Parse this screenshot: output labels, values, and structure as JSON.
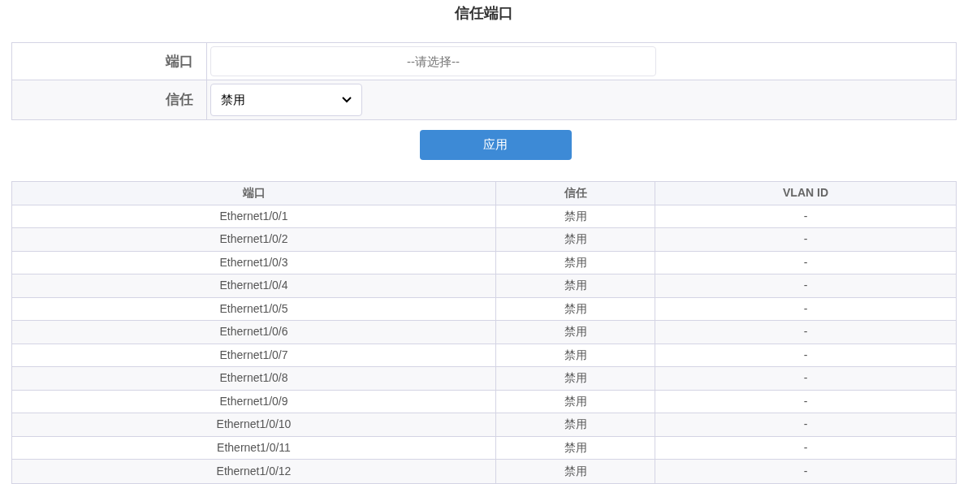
{
  "title": "信任端口",
  "form": {
    "port": {
      "label": "端口",
      "placeholder": "--请选择--"
    },
    "trust": {
      "label": "信任",
      "value": "禁用"
    }
  },
  "apply_button": "应用",
  "table": {
    "columns": [
      "端口",
      "信任",
      "VLAN ID"
    ],
    "rows": [
      [
        "Ethernet1/0/1",
        "禁用",
        "-"
      ],
      [
        "Ethernet1/0/2",
        "禁用",
        "-"
      ],
      [
        "Ethernet1/0/3",
        "禁用",
        "-"
      ],
      [
        "Ethernet1/0/4",
        "禁用",
        "-"
      ],
      [
        "Ethernet1/0/5",
        "禁用",
        "-"
      ],
      [
        "Ethernet1/0/6",
        "禁用",
        "-"
      ],
      [
        "Ethernet1/0/7",
        "禁用",
        "-"
      ],
      [
        "Ethernet1/0/8",
        "禁用",
        "-"
      ],
      [
        "Ethernet1/0/9",
        "禁用",
        "-"
      ],
      [
        "Ethernet1/0/10",
        "禁用",
        "-"
      ],
      [
        "Ethernet1/0/11",
        "禁用",
        "-"
      ],
      [
        "Ethernet1/0/12",
        "禁用",
        "-"
      ]
    ]
  }
}
